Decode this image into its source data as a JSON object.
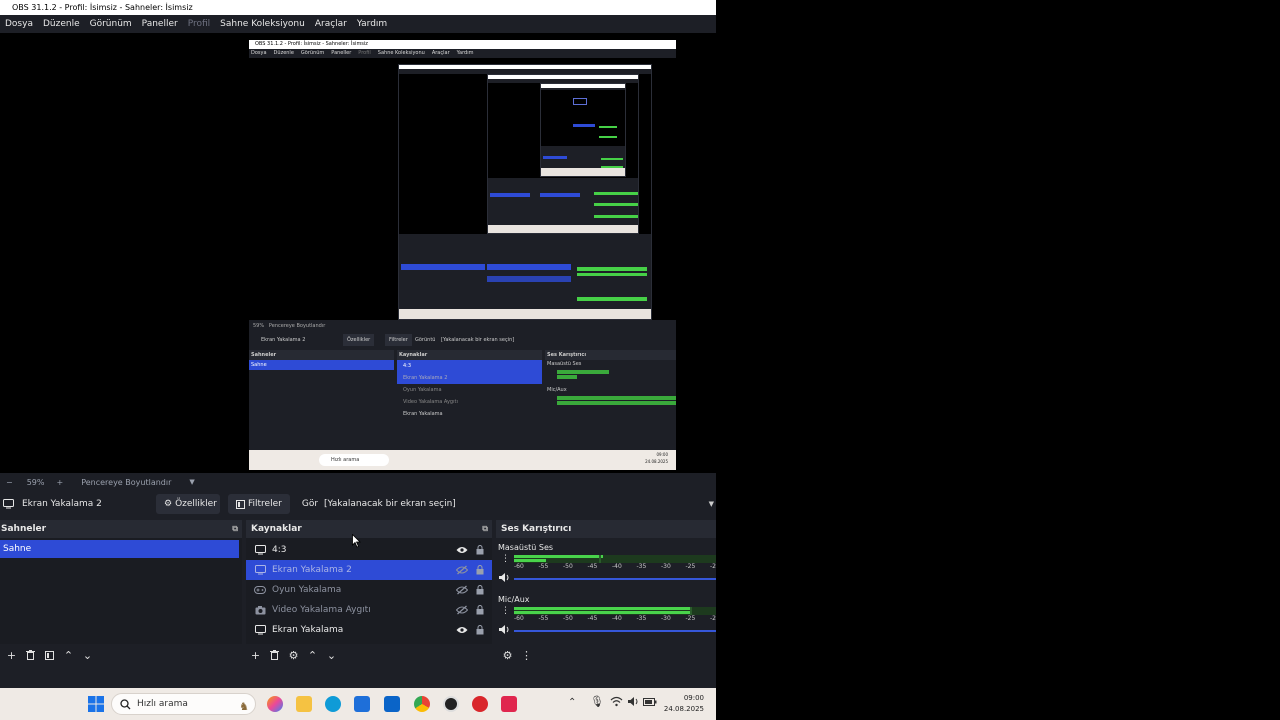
{
  "window": {
    "title": "OBS 31.1.2 - Profil: İsimsiz - Sahneler: İsimsiz"
  },
  "menu": {
    "items": [
      {
        "label": "Dosya",
        "disabled": false
      },
      {
        "label": "Düzenle",
        "disabled": false
      },
      {
        "label": "Görünüm",
        "disabled": false
      },
      {
        "label": "Paneller",
        "disabled": false
      },
      {
        "label": "Profil",
        "disabled": true
      },
      {
        "label": "Sahne Koleksiyonu",
        "disabled": false
      },
      {
        "label": "Araçlar",
        "disabled": false
      },
      {
        "label": "Yardım",
        "disabled": false
      }
    ]
  },
  "preview_nested": {
    "title": "OBS 31.1.2 - Profil: İsimsiz - Sahneler: İsimsiz",
    "menu": [
      "Dosya",
      "Düzenle",
      "Görünüm",
      "Paneller",
      "Profil",
      "Sahne Koleksiyonu",
      "Araçlar",
      "Yardım"
    ],
    "zoom_fit": "Pencereye Boyutlandır",
    "zoom_value": "59%",
    "source_name": "Ekran Yakalama 2",
    "props": "Özellikler",
    "filters": "Filtreler",
    "display_label": "Görüntü",
    "display_value": "[Yakalanacak bir ekran seçin]",
    "scenes_header": "Sahneler",
    "scene": "Sahne",
    "sources_header": "Kaynaklar",
    "sources": [
      "4:3",
      "Ekran Yakalama 2",
      "Oyun Yakalama",
      "Video Yakalama Aygıtı",
      "Ekran Yakalama"
    ],
    "mixer_header": "Ses Karıştırıcı",
    "ch1": "Masaüstü Ses",
    "ch2": "Mic/Aux",
    "search": "Hızlı arama",
    "time": "09:00",
    "date": "24.08.2025"
  },
  "zoom": {
    "minus": "−",
    "value": "59%",
    "plus": "+",
    "fit_label": "Pencereye Boyutlandır"
  },
  "source_toolbar": {
    "source_name": "Ekran Yakalama 2",
    "properties_label": "Özellikler",
    "filters_label": "Filtreler",
    "display_label": "Görüntü",
    "display_value": "[Yakalanacak bir ekran seçin]"
  },
  "scenes": {
    "header": "Sahneler",
    "items": [
      {
        "label": "Sahne",
        "selected": true
      }
    ]
  },
  "sources": {
    "header": "Kaynaklar",
    "items": [
      {
        "label": "4:3",
        "icon": "monitor-icon",
        "visible": true,
        "selected": false
      },
      {
        "label": "Ekran Yakalama 2",
        "icon": "monitor-icon",
        "visible": false,
        "selected": true
      },
      {
        "label": "Oyun Yakalama",
        "icon": "gamepad-icon",
        "visible": false,
        "selected": false
      },
      {
        "label": "Video Yakalama Aygıtı",
        "icon": "camera-icon",
        "visible": false,
        "selected": false
      },
      {
        "label": "Ekran Yakalama",
        "icon": "monitor-icon",
        "visible": true,
        "selected": false
      }
    ]
  },
  "mixer": {
    "header": "Ses Karıştırıcı",
    "channels": [
      {
        "name": "Masaüstü Ses",
        "level_top": 0.44,
        "level_bottom": 0.16,
        "peak": 0.42
      },
      {
        "name": "Mic/Aux",
        "level_top": 0.88,
        "level_bottom": 0.88,
        "peak": 0.87
      }
    ],
    "scale": [
      "-60",
      "-55",
      "-50",
      "-45",
      "-40",
      "-35",
      "-30",
      "-25",
      "-20"
    ]
  },
  "taskbar": {
    "search_placeholder": "Hızlı arama",
    "time": "09:00",
    "date": "24.08.2025"
  },
  "colors": {
    "accent": "#2e4bd6",
    "meter_green": "#49d34b",
    "panel_bg": "#1d1f26",
    "header_bg": "#272a33"
  }
}
